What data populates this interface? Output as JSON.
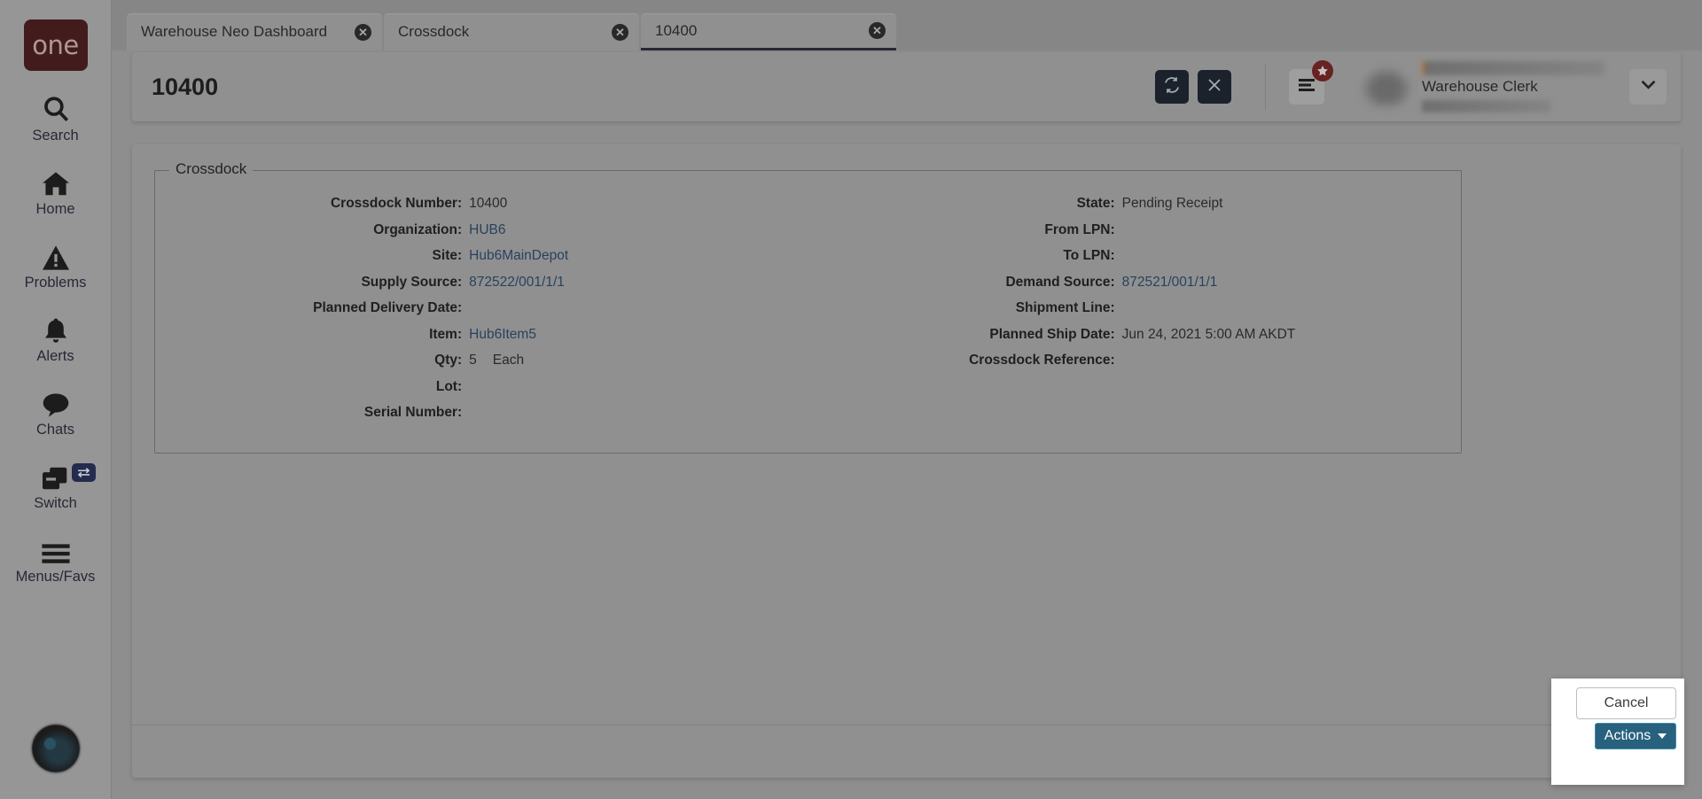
{
  "sidebar": {
    "logo_text": "one",
    "items": [
      {
        "label": "Search",
        "icon": "search-icon"
      },
      {
        "label": "Home",
        "icon": "home-icon"
      },
      {
        "label": "Problems",
        "icon": "warning-triangle-icon"
      },
      {
        "label": "Alerts",
        "icon": "bell-icon"
      },
      {
        "label": "Chats",
        "icon": "chat-bubble-icon"
      },
      {
        "label": "Switch",
        "icon": "windows-stack-icon",
        "badge_icon": "swap-arrows-icon"
      },
      {
        "label": "Menus/Favs",
        "icon": "hamburger-icon"
      }
    ],
    "avatar_icon": "user-avatar-photo"
  },
  "tabs": [
    {
      "label": "Warehouse Neo Dashboard",
      "active": false,
      "closable": true
    },
    {
      "label": "Crossdock",
      "active": false,
      "closable": true
    },
    {
      "label": "10400",
      "active": true,
      "closable": true
    }
  ],
  "header": {
    "title": "10400",
    "refresh_icon": "refresh-sync-icon",
    "close_icon": "close-x-icon",
    "menu_icon": "menu-lines-icon",
    "favorite_badge_icon": "star-icon",
    "user_role": "Warehouse Clerk",
    "user_caret_icon": "chevron-down-icon"
  },
  "panel": {
    "legend": "Crossdock",
    "fields_left": [
      {
        "label": "Crossdock Number:",
        "value": "10400",
        "link": false
      },
      {
        "label": "Organization:",
        "value": "HUB6",
        "link": true
      },
      {
        "label": "Site:",
        "value": "Hub6MainDepot",
        "link": true
      },
      {
        "label": "Supply Source:",
        "value": "872522/001/1/1",
        "link": true
      },
      {
        "label": "Planned Delivery Date:",
        "value": "",
        "link": false
      },
      {
        "label": "Item:",
        "value": "Hub6Item5",
        "link": true
      },
      {
        "label": "Qty:",
        "value": "5",
        "link": false,
        "uom": "Each"
      },
      {
        "label": "Lot:",
        "value": "",
        "link": false
      },
      {
        "label": "Serial Number:",
        "value": "",
        "link": false
      }
    ],
    "fields_right": [
      {
        "label": "State:",
        "value": "Pending Receipt",
        "link": false
      },
      {
        "label": "From LPN:",
        "value": "",
        "link": false
      },
      {
        "label": "To LPN:",
        "value": "",
        "link": false
      },
      {
        "label": "Demand Source:",
        "value": "872521/001/1/1",
        "link": true
      },
      {
        "label": "Shipment Line:",
        "value": "",
        "link": false
      },
      {
        "label": "Planned Ship Date:",
        "value": "Jun 24, 2021 5:00 AM AKDT",
        "link": false
      },
      {
        "label": "Crossdock Reference:",
        "value": "",
        "link": false
      }
    ]
  },
  "actions": {
    "cancel_label": "Cancel",
    "actions_label": "Actions",
    "caret_icon": "caret-down-icon"
  },
  "colors": {
    "brand_maroon": "#3d0d0d",
    "accent_teal": "#27617d",
    "page_bg": "#9b9b9b",
    "card_bg": "#9e9e9e",
    "link_text": "#1b3b5e"
  }
}
